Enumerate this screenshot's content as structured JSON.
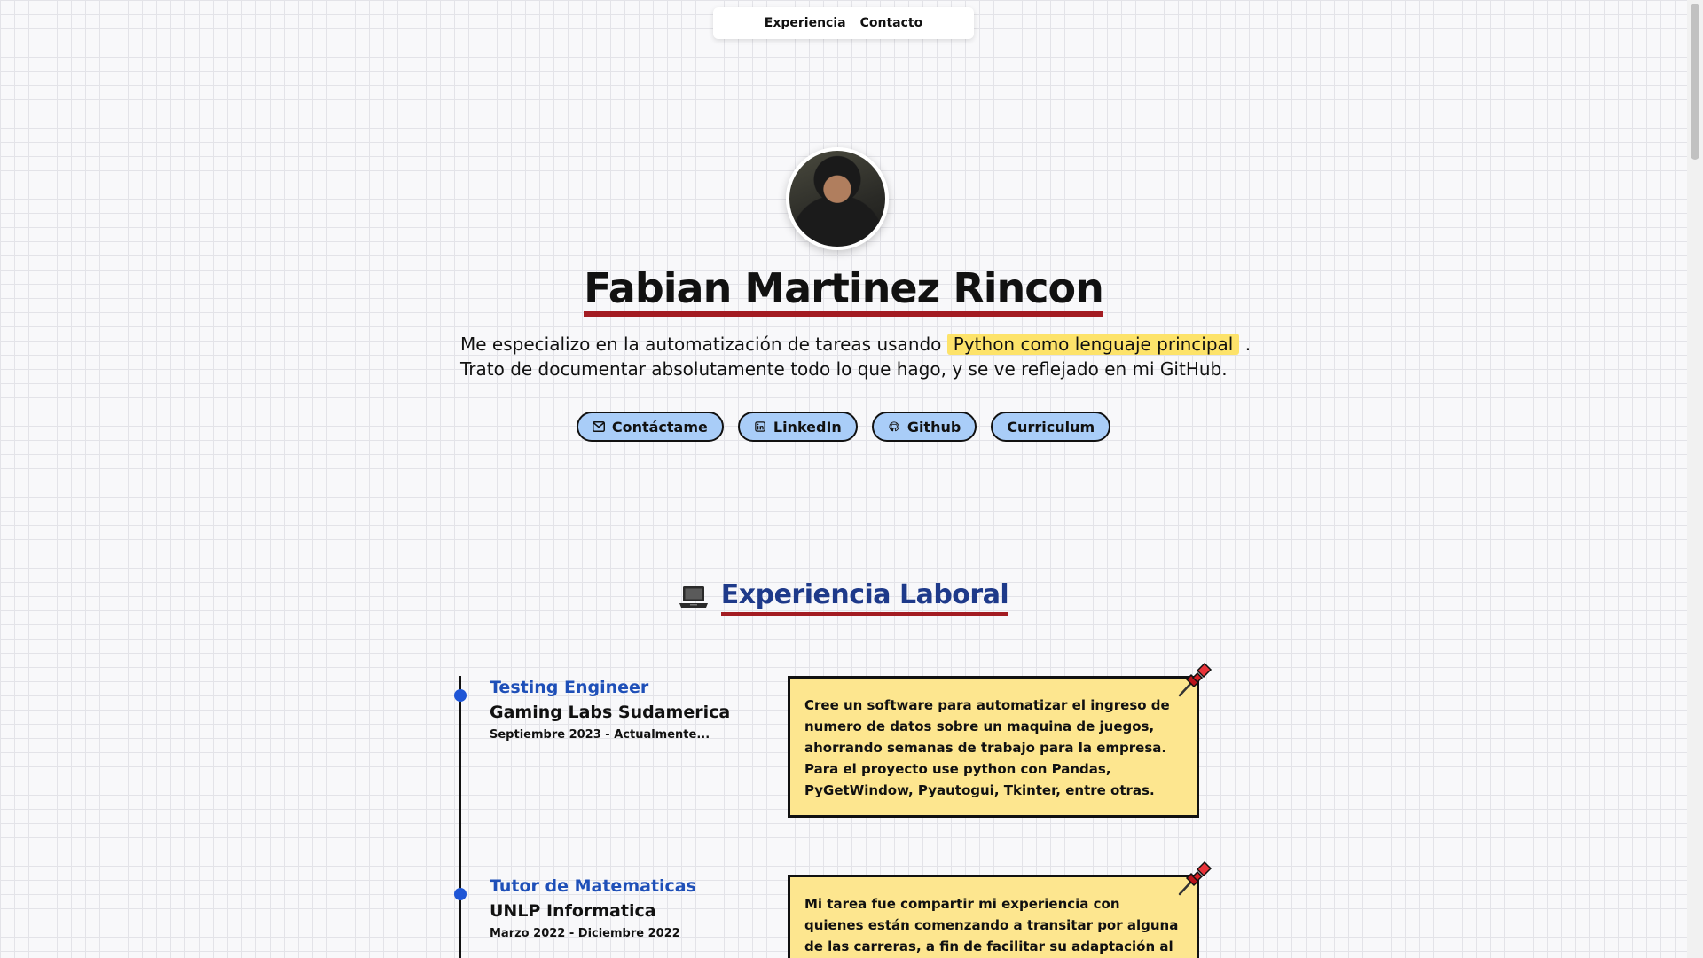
{
  "nav": {
    "items": [
      "Experiencia",
      "Contacto"
    ]
  },
  "hero": {
    "name": "Fabian Martinez Rincon",
    "intro_before": "Me especializo en la automatización de tareas usando ",
    "intro_highlight": "Python como lenguaje principal",
    "intro_after": " .",
    "intro_line2": "Trato de documentar absolutamente todo lo que hago, y se ve reflejado en mi GitHub.",
    "buttons": [
      {
        "label": "Contáctame",
        "icon": "mail-icon"
      },
      {
        "label": "LinkedIn",
        "icon": "linkedin-icon"
      },
      {
        "label": "Github",
        "icon": "github-icon"
      },
      {
        "label": "Curriculum",
        "icon": ""
      }
    ]
  },
  "experience": {
    "title": "Experiencia Laboral",
    "icon": "laptop-icon",
    "jobs": [
      {
        "role": "Testing Engineer",
        "company": "Gaming Labs Sudamerica",
        "dates": "Septiembre 2023 - Actualmente...",
        "description": "Cree un software para automatizar el ingreso de numero de datos sobre un maquina de juegos, ahorrando semanas de trabajo para la empresa. Para el proyecto use python con Pandas, PyGetWindow, Pyautogui, Tkinter, entre otras."
      },
      {
        "role": "Tutor de Matematicas",
        "company": "UNLP Informatica",
        "dates": "Marzo 2022 - Diciembre 2022",
        "description": "Mi tarea fue compartir mi experiencia con quienes están comenzando a transitar por alguna de las carreras, a fin de facilitar su adaptación al"
      }
    ]
  },
  "colors": {
    "accent_blue": "#1e3a8a",
    "underline_red": "#a31c22",
    "button_blue": "#a9cdf8",
    "highlight_yellow": "#fde36a",
    "card_yellow": "#fde68f",
    "timeline_dot": "#1e55d6"
  }
}
